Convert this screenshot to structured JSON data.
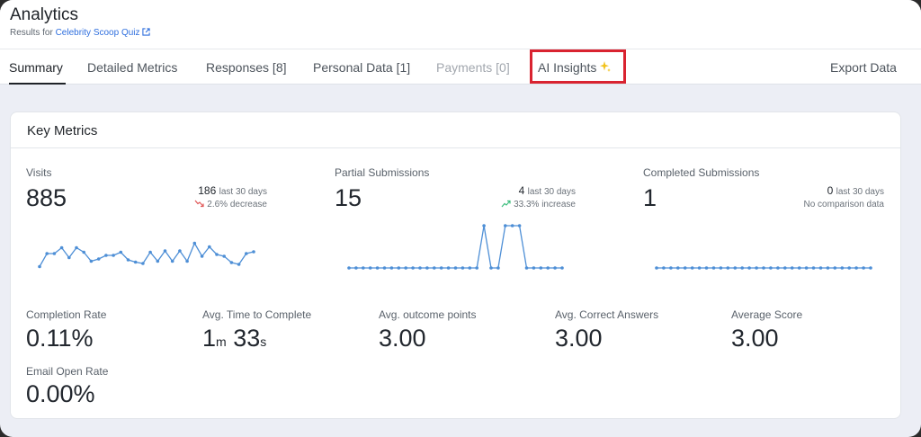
{
  "header": {
    "title": "Analytics",
    "subtitle_prefix": "Results for",
    "quiz_name": "Celebrity Scoop Quiz"
  },
  "tabs": [
    {
      "label": "Summary",
      "state": "active"
    },
    {
      "label": "Detailed Metrics",
      "state": "normal"
    },
    {
      "label": "Responses [8]",
      "state": "normal"
    },
    {
      "label": "Personal Data [1]",
      "state": "normal"
    },
    {
      "label": "Payments [0]",
      "state": "disabled"
    },
    {
      "label": "AI Insights",
      "state": "highlighted",
      "icon": "sparkle-icon"
    },
    {
      "label": "Export Data",
      "state": "normal"
    }
  ],
  "card": {
    "title": "Key Metrics"
  },
  "metrics": {
    "visits": {
      "label": "Visits",
      "value": "885",
      "recent_count": "186",
      "recent_label": "last 30 days",
      "change_text": "2.6% decrease",
      "trend": "down",
      "series": [
        0.13,
        0.42,
        0.42,
        0.55,
        0.33,
        0.55,
        0.45,
        0.25,
        0.3,
        0.38,
        0.38,
        0.45,
        0.28,
        0.23,
        0.2,
        0.45,
        0.25,
        0.48,
        0.25,
        0.48,
        0.25,
        0.65,
        0.36,
        0.57,
        0.4,
        0.36,
        0.22,
        0.18,
        0.42,
        0.46
      ]
    },
    "partial": {
      "label": "Partial Submissions",
      "value": "15",
      "recent_count": "4",
      "recent_label": "last 30 days",
      "change_text": "33.3% increase",
      "trend": "up",
      "series": [
        0,
        0,
        0,
        0,
        0,
        0,
        0,
        0,
        0,
        0,
        0,
        0,
        0,
        0,
        0,
        0,
        0,
        0,
        0,
        1,
        0,
        0,
        1,
        1,
        1,
        0,
        0,
        0,
        0,
        0,
        0
      ]
    },
    "completed": {
      "label": "Completed Submissions",
      "value": "1",
      "recent_count": "0",
      "recent_label": "last 30 days",
      "change_text": "No comparison data",
      "trend": "none",
      "series": [
        0,
        0,
        0,
        0,
        0,
        0,
        0,
        0,
        0,
        0,
        0,
        0,
        0,
        0,
        0,
        0,
        0,
        0,
        0,
        0,
        0,
        0,
        0,
        0,
        0,
        0,
        0,
        0,
        0,
        0,
        0
      ]
    },
    "completion_rate": {
      "label": "Completion Rate",
      "value": "0.11%"
    },
    "avg_time": {
      "label": "Avg. Time to Complete",
      "minutes": "1",
      "minutes_unit": "m",
      "seconds": "33",
      "seconds_unit": "s"
    },
    "avg_outcome": {
      "label": "Avg. outcome points",
      "value": "3.00"
    },
    "avg_correct": {
      "label": "Avg. Correct Answers",
      "value": "3.00"
    },
    "avg_score": {
      "label": "Average Score",
      "value": "3.00"
    },
    "email_open_rate": {
      "label": "Email Open Rate",
      "value": "0.00%"
    }
  },
  "colors": {
    "accent_link": "#2f6fde",
    "highlight_border": "#d92330",
    "sparkline": "#4e8fd6",
    "trend_down": "#e05a5a",
    "trend_up": "#3fbf7f",
    "sparkle": "#f2c21b"
  }
}
